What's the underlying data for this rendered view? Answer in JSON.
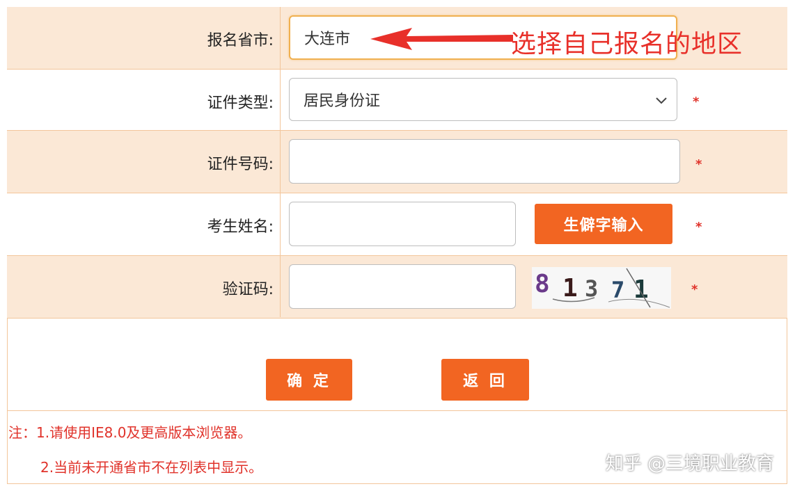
{
  "form": {
    "province": {
      "label": "报名省市:",
      "value": "大连市"
    },
    "id_type": {
      "label": "证件类型:",
      "value": "居民身份证"
    },
    "id_number": {
      "label": "证件号码:",
      "value": ""
    },
    "name": {
      "label": "考生姓名:",
      "value": "",
      "rare_char_button": "生僻字输入"
    },
    "captcha": {
      "label": "验证码:",
      "value": "",
      "image_text": "81371"
    },
    "required_mark": "*"
  },
  "annotation": {
    "text": "选择自己报名的地区"
  },
  "buttons": {
    "confirm": "确 定",
    "back": "返 回"
  },
  "notes": [
    "注：1.请使用IE8.0及更高版本浏览器。",
    "2.当前未开通省市不在列表中显示。"
  ],
  "watermark": "知乎 @三境职业教育",
  "colors": {
    "accent": "#f26522",
    "row_bg": "#fbe8d6",
    "border": "#f3c59a",
    "annotation": "#e8302a"
  }
}
